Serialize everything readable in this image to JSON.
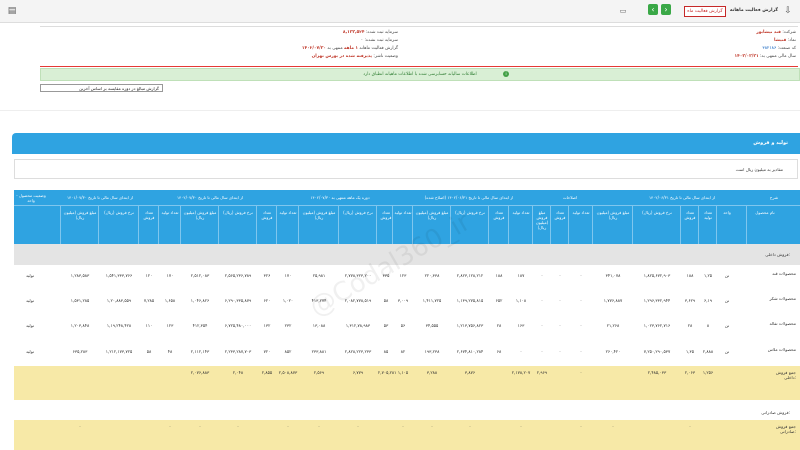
{
  "topbar": {
    "page_title": "گزارش فعالیت ماهانه",
    "badge_label": "گزارش فعالیت ماه",
    "page_number": "1",
    "colors": {
      "nav": "#3aa847",
      "badge_border": "#c62828"
    },
    "icons": [
      "doc-icon",
      "print-icon",
      "download-icon",
      "chevron-right-icon",
      "chevron-left-icon"
    ]
  },
  "info": {
    "company_label": "شرکت:",
    "company_value": "قند نیشابور",
    "symbol_label": "نماد:",
    "symbol_value": "قنیشا",
    "code_label": "کد صنعت:",
    "code_value": "۳۸۲۱۸۶",
    "fiscal_label": "سال مالی منتهی به:",
    "fiscal_value": "۱۴۰۳/۰۳/۳۱",
    "capital_label": "سرمایه ثبت شده:",
    "capital_value": "۸,۱۳۳,۵۲۴",
    "unreg_label": "سرمایه ثبت نشده:",
    "unreg_value": "۰",
    "report_label": "گزارش فعالیت ماهانه",
    "period_label": "۱ ماهه",
    "period_to": "منتهی به",
    "period_date": "۱۴۰۲/۰۷/۳۰",
    "status_label": "وضعیت ناشر:",
    "status_value": "پذیرفته شده در بورس تهران"
  },
  "alert": "اطلاعات سالیانه حسابرسی شده با اطلاعات ماهیانه انطباق دارد",
  "select_value": "گزارش مبالغ در دوره مقایسه بر اساس آخرین",
  "section_title": "تولید و فروش",
  "note": "مقادیر به میلیون ریال است",
  "table": {
    "group_headers": [
      "شرح",
      "از ابتدای سال مالی تا تاریخ ۱۴۰۲/۰۶/۳۱",
      "اصلاحات",
      "از ابتدای سال مالی تا تاریخ ۱۴۰۲/۰۶/۳۱ (اصلاح شده)",
      "دوره یک ماهه منتهی به ۱۴۰۲/۰۷/۳۰",
      "از ابتدای سال مالی تا تاریخ ۱۴۰۲/۰۷/۳۰",
      "از ابتدای سال مالی تا تاریخ ۱۴۰۱/۰۷/۳۰",
      "وضعیت محصول - واحد"
    ],
    "sub_headers": [
      "نام محصول",
      "واحد",
      "تعداد تولید",
      "تعداد فروش",
      "نرخ فروش (ریال)",
      "مبلغ فروش (میلیون ریال)",
      "تعداد تولید",
      "تعداد فروش",
      "مبلغ فروش (میلیون ریال)",
      "تعداد تولید",
      "تعداد فروش",
      "نرخ فروش (ریال)",
      "مبلغ فروش (میلیون ریال)",
      "تعداد تولید",
      "تعداد فروش",
      "نرخ فروش (ریال)",
      "مبلغ فروش (میلیون ریال)",
      "تعداد تولید",
      "تعداد فروش",
      "نرخ فروش (ریال)",
      "مبلغ فروش (میلیون ریال)",
      "تعداد تولید",
      "تعداد فروش",
      "نرخ فروش (ریال)",
      "مبلغ فروش (میلیون ریال)"
    ],
    "group_domestic": "فروش داخلی:",
    "rows": [
      {
        "name": "محصولات قند",
        "cells": [
          "تن",
          "۱,۲۵",
          "۱۸۸",
          "۱,۸۲۵,۶۷۲,۹۰۳",
          "۳۴۱,۰۷۸",
          "۰",
          "۰",
          "۰",
          "۱۸۷",
          "۱۸۸",
          "۲,۸۲۳,۱۲۸,۲۱۲",
          "۲۲۰,۳۳۸",
          "۱۲۳",
          "۳۳۵",
          "۲,۷۷۸,۳۲۳,۲۰۰",
          "۲۵,۹۸۱",
          "۱۷۰",
          "۳۲۶",
          "۲,۵۶۵,۲۳۶,۷۸۹",
          "۲,۵۱۲,۰۸۳",
          "۱۷۰",
          "۱۲۰",
          "۱,۵۴۱,۳۳۳,۷۶۶",
          "۱,۲۸۳,۵۸۳"
        ],
        "status": "تولید"
      },
      {
        "name": "محصولات شکر",
        "cells": [
          "تن",
          "۶,۱۹",
          "۳,۶۲۹",
          "۱,۲۹۶,۳۳۲,۹۴۴",
          "۱,۷۷۶,۸۸۷",
          "۰",
          "۰",
          "۰",
          "۱,۱۰۸",
          "۶۵۲",
          "۱,۱۳۹,۲۷۵,۸۱۵",
          "۱,۴۱۱,۷۲۵",
          "۳,۰۰۹",
          "۵۸",
          "۲,۰۸۲,۷۷۸,۵۱۹",
          "۴۱۳,۲۷۴",
          "۱,۰۲۰",
          "۶۲۰",
          "۶,۲۹۰,۳۳۵,۸۷۹",
          "۱,۰۴۶,۸۲۶",
          "۱,۶۵۸",
          "۷,۲۸۵",
          "۱,۲۰,۸۸۳,۵۵۹",
          "۱,۵۳۱,۲۸۵"
        ],
        "status": "تولید"
      },
      {
        "name": "محصولات تفاله",
        "cells": [
          "تن",
          "۸",
          "۲۸",
          "۱,۰۲۳,۷۶۲,۷۱۶",
          "۲۱,۲۶۸",
          "۰",
          "۰",
          "۰",
          "۱۶۳",
          "۲۸",
          "۱,۲۱۳,۷۵۶,۸۲۳",
          "۳۴,۵۵۵",
          "۵۶",
          "۵۳",
          "۱,۳۱۲,۷۸,۹۸۳",
          "۱۳,۰۸۸",
          "۲۳۲",
          "۱۳۲",
          "۶,۷۲۵,۴۸۰,۰۰۰",
          "۴۱۲,۳۵۴",
          "۱۲۳",
          "۱۱۰",
          "۱,۱۹,۲۴۸,۴۲۸",
          "۱,۲۰۳,۸۴۸"
        ],
        "status": "تولید"
      },
      {
        "name": "محصولات ملاس",
        "cells": [
          "تن",
          "۲,۸۸۸",
          "۱,۳۵",
          "۷,۲۵۰,۲۹۰,۵۳۷",
          "۲۶۰,۴۲۰",
          "۰",
          "۰",
          "۰",
          "۰",
          "۶۸",
          "۲,۶۷۴,۸۱۰,۲۸۴",
          "۱۹۳,۲۳۸",
          "۸۲",
          "۸۵",
          "۲,۸۲۸,۲۲۳,۲۳۳",
          "۲۳۳,۸۸۱",
          "۸۵۲",
          "۷۲۰",
          "۲,۲۳۳,۲۸۷,۷۰۳",
          "۲,۱۱۲,۱۴۳",
          "۴۸",
          "۵۸",
          "۱,۲۱۲,۱۷۳,۷۲۵",
          "۶۳۵,۲۸۳"
        ],
        "status": "تولید"
      }
    ],
    "subtotal_label": "جمع فروش داخلی:",
    "subtotal": [
      "۱,۲۵۶",
      "۲,۰۶۳",
      "۲,۴۸۵,۰۳۳",
      "",
      "۰",
      "",
      "۲,۹۶۹",
      "۲,۱۷۸,۲۰۷",
      "",
      "۳,۸۷۶",
      "۳,۲۸۸",
      "۱,۱۰۵",
      "۲,۷۰۵,۲۸۱",
      "۶,۷۷۹",
      "۲,۵۶۹",
      "۲,۵۰۸,۸۷۳",
      "۲,۸۵۵",
      "۲,۰۴۸",
      "۲,۰۷۶,۸۸۳"
    ],
    "group_export": "فروش صادراتی:",
    "export_total_label": "جمع فروش صادراتی:",
    "export_total": [
      "۰",
      "۰",
      "۰",
      "۰",
      "۰",
      "۰",
      "۰",
      "۰",
      "۰",
      "۰",
      "۰",
      "۰",
      "۰",
      "۰"
    ]
  }
}
